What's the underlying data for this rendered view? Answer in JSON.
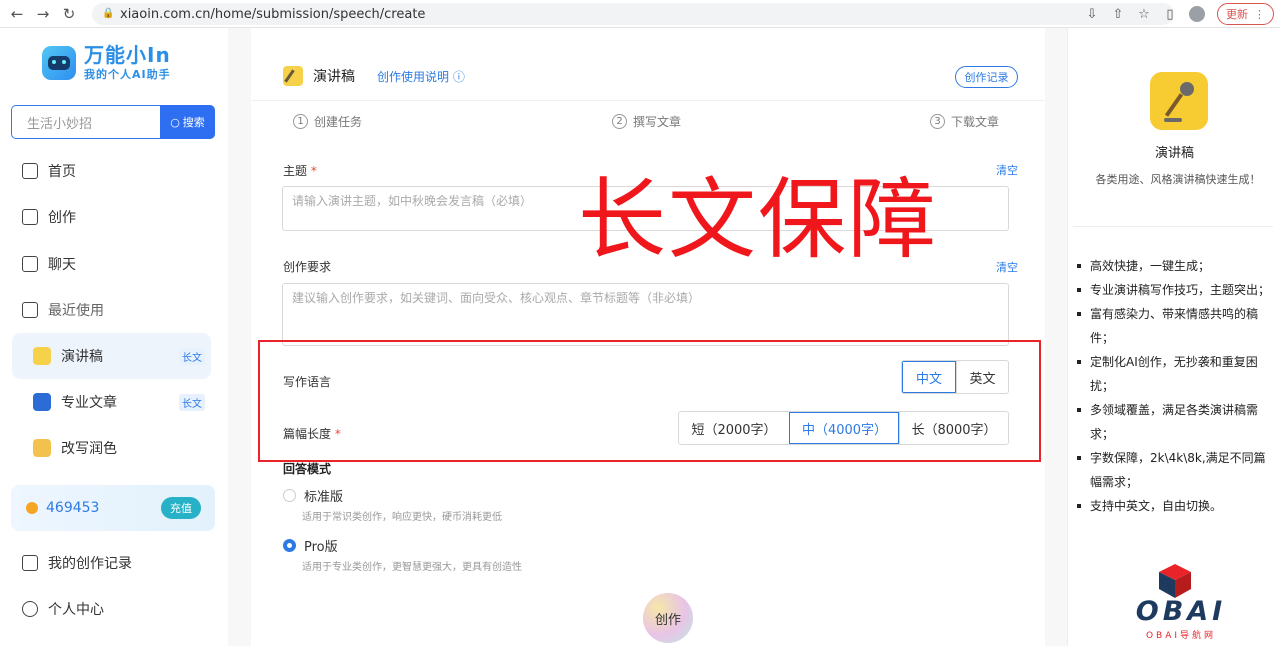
{
  "browser": {
    "url": "xiaoin.com.cn/home/submission/speech/create",
    "update_label": "更新"
  },
  "sidebar": {
    "logo_title": "万能小In",
    "logo_sub": "我的个人AI助手",
    "search_placeholder": "生活小妙招",
    "search_button": "搜索",
    "items": [
      {
        "label": "首页",
        "icon": "home-icon"
      },
      {
        "label": "创作",
        "icon": "edit-icon"
      },
      {
        "label": "聊天",
        "icon": "chat-icon"
      },
      {
        "label": "最近使用",
        "icon": "recent-icon"
      }
    ],
    "recent": [
      {
        "label": "演讲稿",
        "tag": "长文"
      },
      {
        "label": "专业文章",
        "tag": "长文"
      },
      {
        "label": "改写润色",
        "tag": ""
      }
    ],
    "coins": "469453",
    "recharge": "充值",
    "bottom_items": [
      {
        "label": "我的创作记录",
        "icon": "records-icon"
      },
      {
        "label": "个人中心",
        "icon": "user-icon"
      }
    ]
  },
  "panel": {
    "title": "演讲稿",
    "help_link": "创作使用说明 ⓘ",
    "records_button": "创作记录",
    "steps": [
      {
        "num": "1",
        "label": "创建任务"
      },
      {
        "num": "2",
        "label": "撰写文章"
      },
      {
        "num": "3",
        "label": "下载文章"
      }
    ],
    "topic": {
      "label": "主题",
      "required": "*",
      "clear": "清空",
      "placeholder": "请输入演讲主题，如中秋晚会发言稿（必填）"
    },
    "requirements": {
      "label": "创作要求",
      "clear": "清空",
      "placeholder": "建议输入创作要求，如关键词、面向受众、核心观点、章节标题等（非必填）"
    },
    "language": {
      "label": "写作语言",
      "options": [
        "中文",
        "英文"
      ],
      "selected": "中文"
    },
    "length": {
      "label": "篇幅长度",
      "required": "*",
      "options": [
        "短（2000字）",
        "中（4000字）",
        "长（8000字）"
      ],
      "selected": "中（4000字）"
    },
    "mode": {
      "title": "回答模式",
      "options": [
        {
          "label": "标准版",
          "desc": "适用于常识类创作，响应更快，硬币消耗更低",
          "selected": false
        },
        {
          "label": "Pro版",
          "desc": "适用于专业类创作，更智慧更强大，更具有创造性",
          "selected": true
        }
      ]
    },
    "create_button": "创作",
    "watermark": "长文保障"
  },
  "right": {
    "title": "演讲稿",
    "subtitle": "各类用途、风格演讲稿快速生成！",
    "features": [
      "高效快捷，一键生成；",
      "专业演讲稿写作技巧，主题突出；",
      "富有感染力、带来情感共鸣的稿件；",
      "定制化AI创作，无抄袭和重复困扰；",
      "多领域覆盖，满足各类演讲稿需求；",
      "字数保障，2k\\4k\\8k,满足不同篇幅需求；",
      "支持中英文，自由切换。"
    ],
    "brand": "OBAI",
    "brand_sub": "OBAI导航网"
  },
  "colors": {
    "accent": "#2c7be5",
    "watermark_red": "#f0171c",
    "frame_red": "#e8232a"
  }
}
